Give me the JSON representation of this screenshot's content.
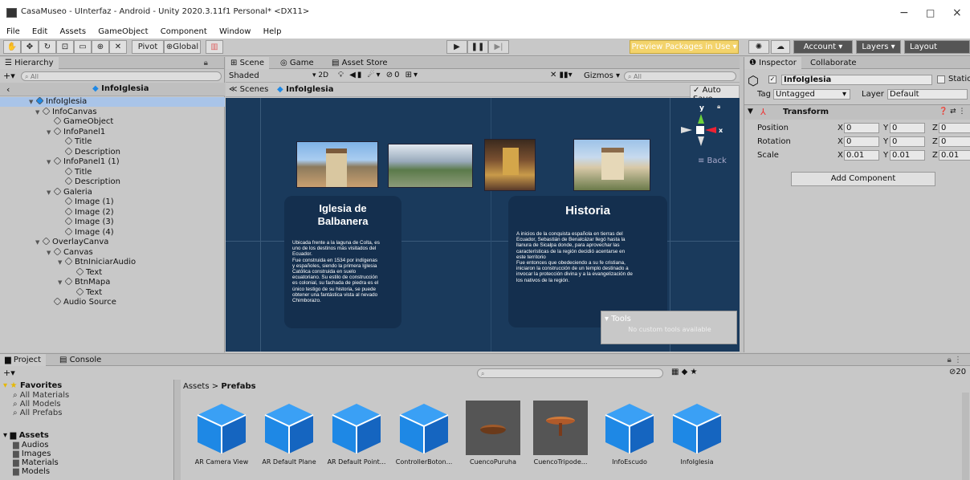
{
  "window": {
    "title": "CasaMuseo - UInterfaz - Android - Unity 2020.3.11f1 Personal* <DX11>",
    "minimize": "−",
    "maximize": "□",
    "close": "×"
  },
  "menu": [
    "File",
    "Edit",
    "Assets",
    "GameObject",
    "Component",
    "Window",
    "Help"
  ],
  "toolbar": {
    "pivot": "Pivot",
    "global": "Global",
    "preview_packages": "Preview Packages in Use ▾",
    "account": "Account ▾",
    "layers": "Layers ▾",
    "layout": "Layout"
  },
  "hierarchy": {
    "tab": "Hierarchy",
    "search_placeholder": "All",
    "root": "InfoIglesia",
    "items": [
      {
        "label": "InfoIglesia",
        "expanded": "▼"
      },
      {
        "label": "InfoCanvas",
        "expanded": "▼"
      },
      {
        "label": "GameObject",
        "expanded": ""
      },
      {
        "label": "InfoPanel1",
        "expanded": "▼"
      },
      {
        "label": "Title",
        "expanded": ""
      },
      {
        "label": "Description",
        "expanded": ""
      },
      {
        "label": "InfoPanel1 (1)",
        "expanded": "▼"
      },
      {
        "label": "Title",
        "expanded": ""
      },
      {
        "label": "Description",
        "expanded": ""
      },
      {
        "label": "Galeria",
        "expanded": "▼"
      },
      {
        "label": "Image (1)",
        "expanded": ""
      },
      {
        "label": "Image (2)",
        "expanded": ""
      },
      {
        "label": "Image (3)",
        "expanded": ""
      },
      {
        "label": "Image (4)",
        "expanded": ""
      },
      {
        "label": "OverlayCanva",
        "expanded": "▼"
      },
      {
        "label": "Canvas",
        "expanded": "▼"
      },
      {
        "label": "BtnIniciarAudio",
        "expanded": "▼"
      },
      {
        "label": "Text",
        "expanded": ""
      },
      {
        "label": "BtnMapa",
        "expanded": "▼"
      },
      {
        "label": "Text",
        "expanded": ""
      },
      {
        "label": "Audio Source",
        "expanded": ""
      }
    ]
  },
  "scene": {
    "tabs": [
      "Scene",
      "Game",
      "Asset Store"
    ],
    "shading": "Shaded",
    "mode_2d": "2D",
    "gizmos": "Gizmos ▾",
    "search_placeholder": "All",
    "breadcrumb_scenes": "Scenes",
    "breadcrumb_prefab": "InfoIglesia",
    "auto_save": "Auto Save",
    "back_label": "≡ Back",
    "axis_x": "x",
    "axis_y": "y",
    "card1": {
      "title": "Iglesia de\nBalbanera",
      "body": "Ubicada frente a la laguna de Colta, es\nuno de los destinos más visitados del\nEcuador.\nFue construida en 1534 por indígenas\ny españoles, siendo la primera Iglesia\nCatólica    construida    en    suelo\necuatoriano. Su estilo de construcción\nes colonial, su fachada de piedra es el\núnico testigo de su historia, se puede\nobtener una fantástica vista al nevado\nChimborazo."
    },
    "card2": {
      "title": "Historia",
      "body": "A inicios de la conquista española en tierras del\nEcuador, Sebastián de Benalcázar llegó hasta la\nllanura de Sicalpa donde, para aprovechar las\ncaracterísticas de la región decidió acentarse en\neste territorio\nFue entonces que obedeciendo a su fe cristiana,\niniciaron la construcción de un templo destinado a\ninvocar la protección divina y a la evangelización de\nlos nativos de la región."
    },
    "tools": {
      "title": "Tools",
      "message": "No custom tools available"
    }
  },
  "inspector": {
    "tabs": [
      "Inspector",
      "Collaborate"
    ],
    "object_name": "InfoIglesia",
    "static": "Static",
    "tag_label": "Tag",
    "tag_value": "Untagged",
    "layer_label": "Layer",
    "layer_value": "Default",
    "transform_title": "Transform",
    "rows": [
      {
        "label": "Position",
        "x": "0",
        "y": "0",
        "z": "0"
      },
      {
        "label": "Rotation",
        "x": "0",
        "y": "0",
        "z": "0"
      },
      {
        "label": "Scale",
        "x": "0.01",
        "y": "0.01",
        "z": "0.01"
      }
    ],
    "add_component": "Add Component"
  },
  "project": {
    "tabs": [
      "Project",
      "Console"
    ],
    "count": "20",
    "favorites": {
      "title": "Favorites",
      "items": [
        "All Materials",
        "All Models",
        "All Prefabs"
      ]
    },
    "assets": {
      "title": "Assets",
      "items": [
        "Audios",
        "Images",
        "Materials",
        "Models"
      ]
    },
    "breadcrumb_root": "Assets",
    "breadcrumb_sep": ">",
    "breadcrumb_folder": "Prefabs",
    "items": [
      {
        "label": "AR Camera View",
        "kind": "cube"
      },
      {
        "label": "AR Default Plane",
        "kind": "cube"
      },
      {
        "label": "AR Default Point...",
        "kind": "cube"
      },
      {
        "label": "ControllerBoton...",
        "kind": "cube"
      },
      {
        "label": "CuencoPuruha",
        "kind": "bowl"
      },
      {
        "label": "CuencoTripode...",
        "kind": "tripod"
      },
      {
        "label": "InfoEscudo",
        "kind": "cube"
      },
      {
        "label": "InfoIglesia",
        "kind": "cube"
      }
    ]
  },
  "colors": {
    "accent": "#1e88e5",
    "scene_bg": "#1a3a5c",
    "card_bg": "#142f4e",
    "selected": "#a9c4e8"
  }
}
